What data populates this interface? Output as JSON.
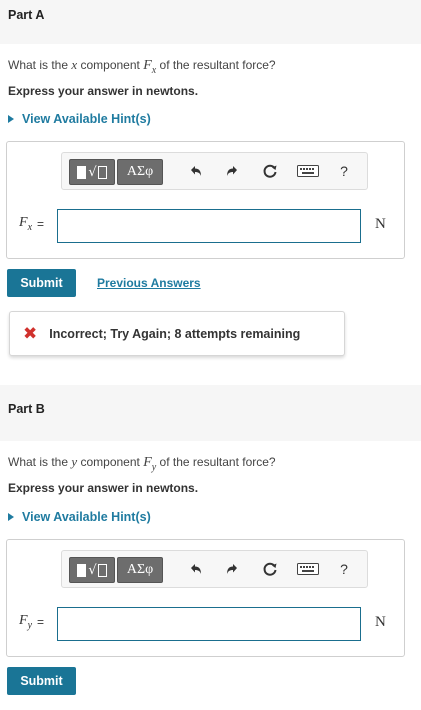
{
  "part_a": {
    "title": "Part A",
    "question_before": "What is the ",
    "question_var": "x",
    "question_mid": " component ",
    "question_after": " of the resultant force?",
    "symbol": "F",
    "subscript": "x",
    "express": "Express your answer in newtons.",
    "hint": "View Available Hint(s)",
    "answer_value": "",
    "unit": "N",
    "submit_label": "Submit",
    "previous_answers_label": "Previous Answers",
    "feedback": "Incorrect; Try Again; 8 attempts remaining"
  },
  "part_b": {
    "title": "Part B",
    "question_before": "What is the ",
    "question_var": "y",
    "question_mid": " component ",
    "question_after": " of the resultant force?",
    "symbol": "F",
    "subscript": "y",
    "express": "Express your answer in newtons.",
    "hint": "View Available Hint(s)",
    "answer_value": "",
    "unit": "N",
    "submit_label": "Submit"
  },
  "toolbar": {
    "greek_label": "ΑΣφ",
    "help_label": "?",
    "icons": [
      "templates-icon",
      "greek-symbols-icon",
      "undo-icon",
      "redo-icon",
      "reset-icon",
      "keyboard-icon",
      "help-icon"
    ]
  },
  "equals": "=",
  "colors": {
    "accent": "#1a7596",
    "link": "#1f7ba0",
    "error": "#d0312d",
    "header_bg": "#f6f6f6"
  }
}
